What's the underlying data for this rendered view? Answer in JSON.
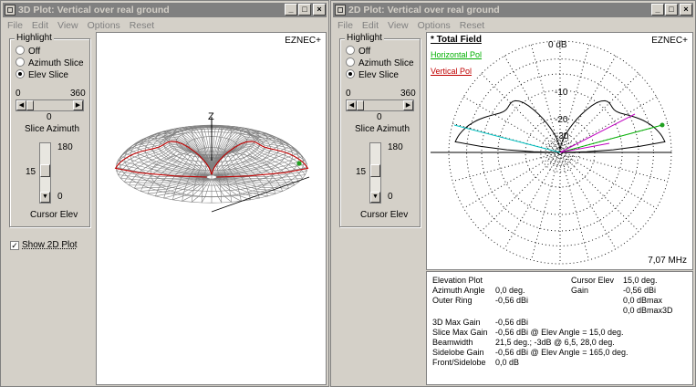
{
  "left": {
    "title": "3D Plot: Vertical over real ground",
    "menu": [
      "File",
      "Edit",
      "View",
      "Options",
      "Reset"
    ],
    "highlight": {
      "legend": "Highlight",
      "options": [
        "Off",
        "Azimuth Slice",
        "Elev Slice"
      ],
      "selected": 2
    },
    "slice_azimuth": {
      "min": "0",
      "max": "360",
      "value": "0",
      "label": "Slice Azimuth"
    },
    "cursor_elev": {
      "max": "180",
      "value": "15",
      "min": "0",
      "label": "Cursor Elev"
    },
    "show_2d": {
      "label": "Show 2D Plot",
      "checked": true
    },
    "brand": "EZNEC+",
    "axis_label": "Z"
  },
  "right": {
    "title": "2D Plot: Vertical over real ground",
    "menu": [
      "File",
      "Edit",
      "View",
      "Options",
      "Reset"
    ],
    "highlight": {
      "legend": "Highlight",
      "options": [
        "Off",
        "Azimuth Slice",
        "Elev Slice"
      ],
      "selected": 2
    },
    "slice_azimuth": {
      "min": "0",
      "max": "360",
      "value": "0",
      "label": "Slice Azimuth"
    },
    "cursor_elev": {
      "max": "180",
      "value": "15",
      "min": "0",
      "label": "Cursor Elev"
    },
    "brand": "EZNEC+",
    "legend": {
      "total": "* Total Field",
      "horizontal": "Horizontal Pol",
      "vertical": "Vertical Pol"
    },
    "ring_labels": {
      "outer": "0 dB",
      "r10": "-10",
      "r20": "-20",
      "r30": "-30"
    },
    "frequency": "7,07 MHz",
    "info": {
      "plot_type": "Elevation Plot",
      "azimuth_angle_label": "Azimuth Angle",
      "azimuth_angle": "0,0 deg.",
      "outer_ring_label": "Outer Ring",
      "outer_ring": "-0,56 dBi",
      "cursor_elev_label": "Cursor Elev",
      "cursor_elev": "15,0 deg.",
      "gain_label": "Gain",
      "gain_dbi": "-0,56 dBi",
      "gain_dbmax": "0,0 dBmax",
      "gain_dbmax3d": "0,0 dBmax3D",
      "max_gain_3d_label": "3D Max Gain",
      "max_gain_3d": "-0,56 dBi",
      "slice_max_gain_label": "Slice Max Gain",
      "slice_max_gain": "-0,56 dBi @ Elev Angle = 15,0 deg.",
      "beamwidth_label": "Beamwidth",
      "beamwidth": "21,5 deg.; -3dB @ 6,5, 28,0 deg.",
      "sidelobe_gain_label": "Sidelobe Gain",
      "sidelobe_gain": "-0,56 dBi @ Elev Angle = 165,0 deg.",
      "front_sidelobe_label": "Front/Sidelobe",
      "front_sidelobe": "0,0 dB"
    }
  },
  "colors": {
    "total": "#000000",
    "horizontal": "#00b000",
    "vertical": "#c00000",
    "cursor_cyan": "#00c0c0",
    "cursor_magenta": "#c000c0",
    "mesh": "#808080"
  }
}
